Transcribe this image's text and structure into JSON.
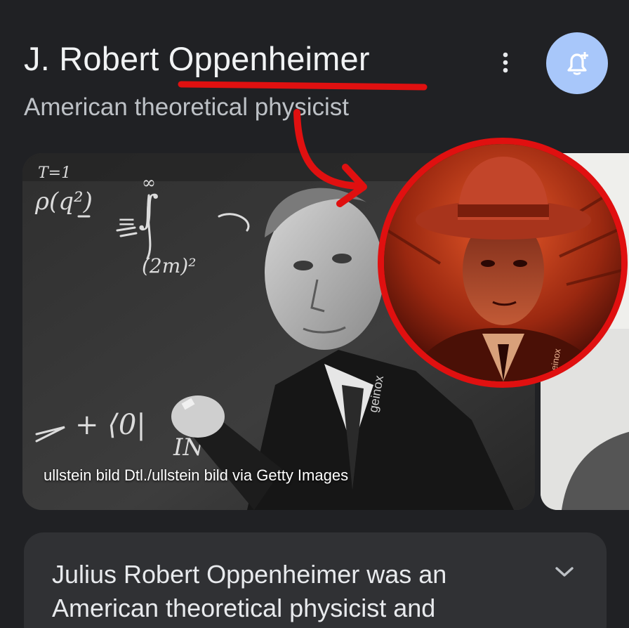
{
  "header": {
    "title": "J. Robert Oppenheimer",
    "subtitle": "American theoretical physicist"
  },
  "actions": {
    "more_icon": "more-vert-icon",
    "notify_icon": "add-alert-bell-icon",
    "accent_color": "#a8c7fa"
  },
  "image_carousel": {
    "main_image_credit": "ullstein bild Dtl./ullstein bild via Getty Images",
    "chalkboard_text": [
      "T=1",
      "ρ(q²)",
      "=",
      "∞",
      "∫",
      "(2m)²",
      "+ ⟨0|",
      "IN"
    ],
    "watermark": "geinox",
    "inset_watermark": "geinox"
  },
  "annotation": {
    "color": "#e01010",
    "marks": [
      "underline-title",
      "curved-arrow",
      "circle-inset"
    ]
  },
  "description": {
    "text": "Julius Robert Oppenheimer was an American theoretical physicist and",
    "expand_icon": "chevron-down-icon"
  }
}
